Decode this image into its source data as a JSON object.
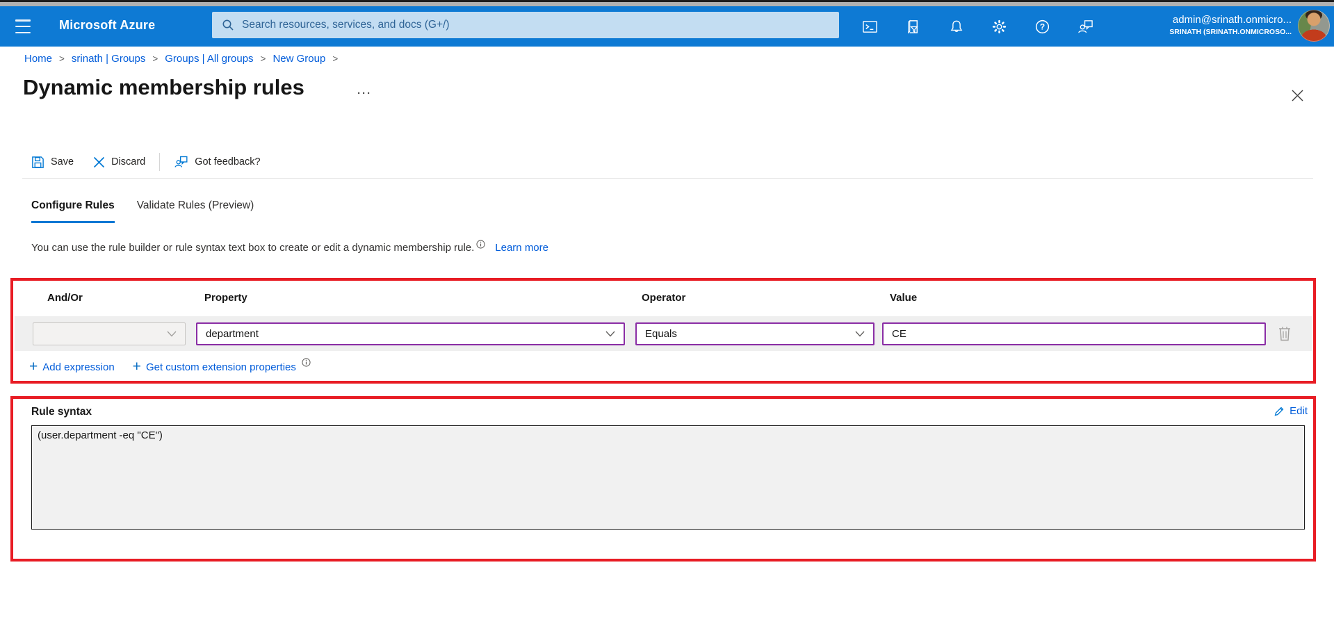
{
  "topbar": {
    "brand": "Microsoft Azure",
    "search_placeholder": "Search resources, services, and docs (G+/)",
    "user": {
      "email": "admin@srinath.onmicro...",
      "tenant": "SRINATH (SRINATH.ONMICROSO..."
    }
  },
  "breadcrumb": {
    "separator": ">",
    "items": [
      "Home",
      "srinath | Groups",
      "Groups | All groups",
      "New Group"
    ]
  },
  "page": {
    "title": "Dynamic membership rules",
    "more_options": "···"
  },
  "toolbar": {
    "save": "Save",
    "discard": "Discard",
    "feedback": "Got feedback?"
  },
  "tabs": [
    {
      "label": "Configure Rules",
      "active": true
    },
    {
      "label": "Validate Rules (Preview)",
      "active": false
    }
  ],
  "description": {
    "text": "You can use the rule builder or rule syntax text box to create or edit a dynamic membership rule.",
    "learn_more": "Learn more"
  },
  "rule_builder": {
    "columns": [
      "And/Or",
      "Property",
      "Operator",
      "Value"
    ],
    "row": {
      "and_or": "",
      "property": "department",
      "operator": "Equals",
      "value": "CE"
    },
    "add_expression": "Add expression",
    "get_custom_extension": "Get custom extension properties"
  },
  "rule_syntax": {
    "label": "Rule syntax",
    "edit": "Edit",
    "value": "(user.department -eq \"CE\")"
  },
  "colors": {
    "topbar_blue": "#0e7ad4",
    "accent_blue": "#0078d4",
    "link_blue": "#015cda",
    "highlight_red": "#e81c24",
    "focus_purple": "#8a2da5"
  }
}
